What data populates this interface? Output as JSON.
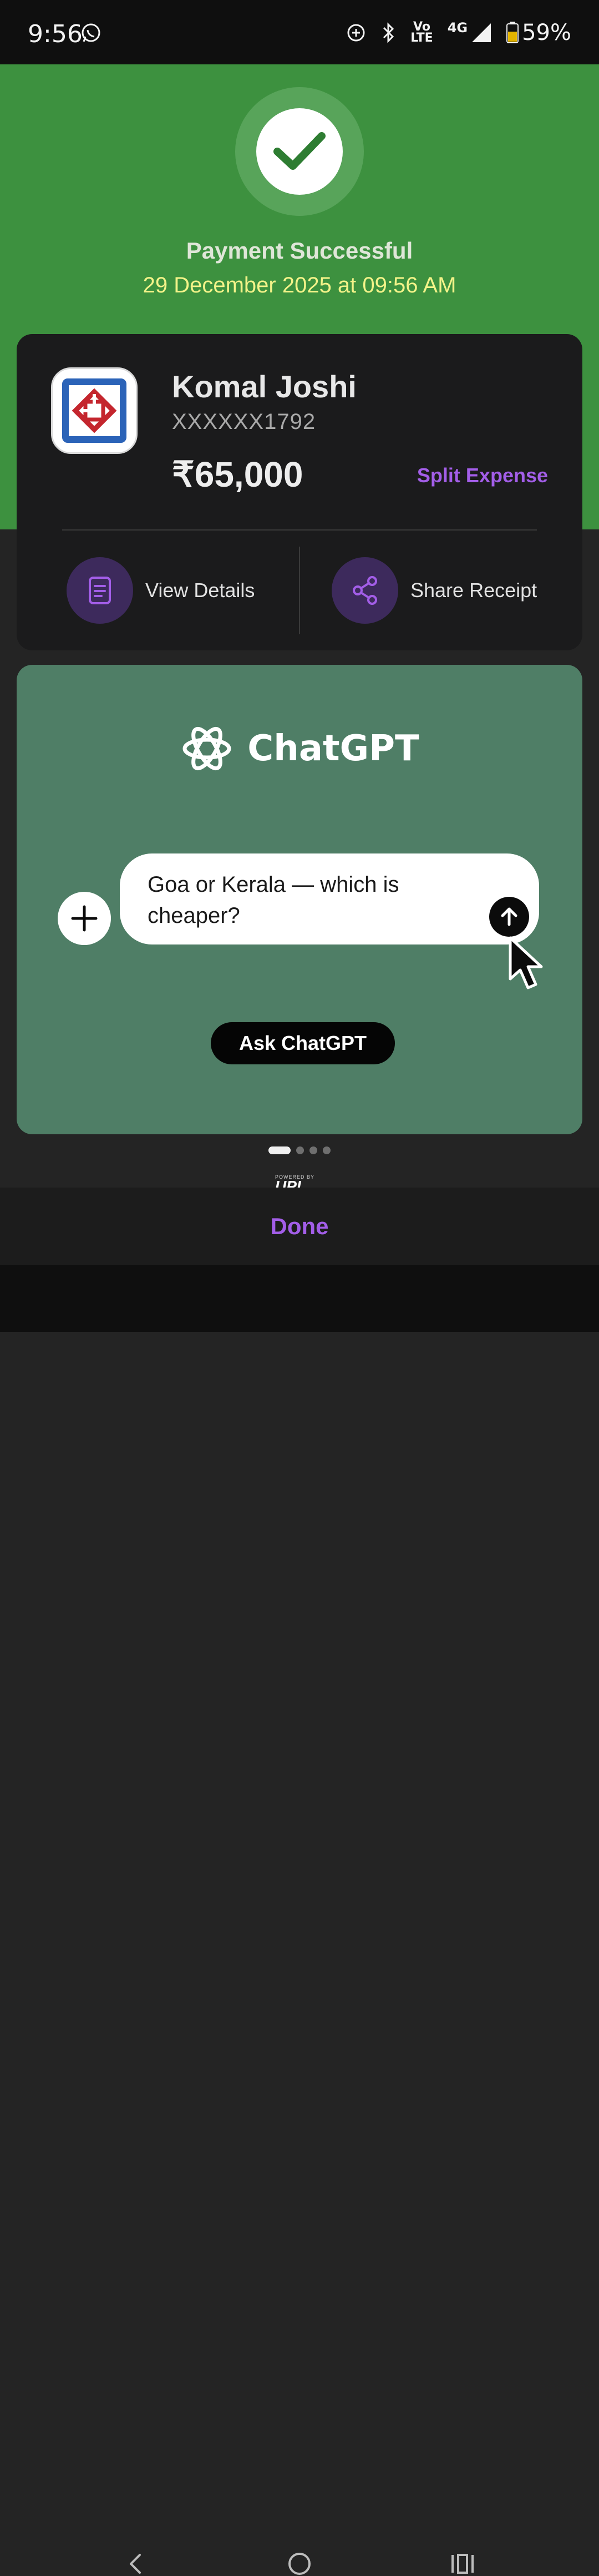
{
  "status_bar": {
    "time": "9:56",
    "network_label_top": "Vo",
    "network_label_bottom": "LTE",
    "network_type": "4G",
    "battery": "59%",
    "icons": [
      "whatsapp-icon",
      "data-saver-icon",
      "bluetooth-icon",
      "volte-icon",
      "signal-icon",
      "battery-icon"
    ]
  },
  "header": {
    "title": "Payment Successful",
    "datetime": "29 December 2025 at 09:56 AM",
    "accent_color": "#3d913f"
  },
  "payee": {
    "name": "Komal Joshi",
    "account": "XXXXXX1792",
    "amount": "₹65,000",
    "split_label": "Split Expense",
    "logo_icon": "bank-logo-icon"
  },
  "actions": {
    "view_details": "View Details",
    "share_receipt": "Share Receipt"
  },
  "promo": {
    "brand": "ChatGPT",
    "prompt_text": "Goa or Kerala — which is cheaper?",
    "cta": "Ask ChatGPT",
    "background": "#4f7e66",
    "pager": {
      "total": 4,
      "active": 1
    }
  },
  "footer": {
    "upi_caption": "POWERED BY",
    "upi_brand": "UPI",
    "done_label": "Done"
  },
  "nav": {
    "items": [
      "back-icon",
      "home-icon",
      "recents-icon"
    ]
  }
}
